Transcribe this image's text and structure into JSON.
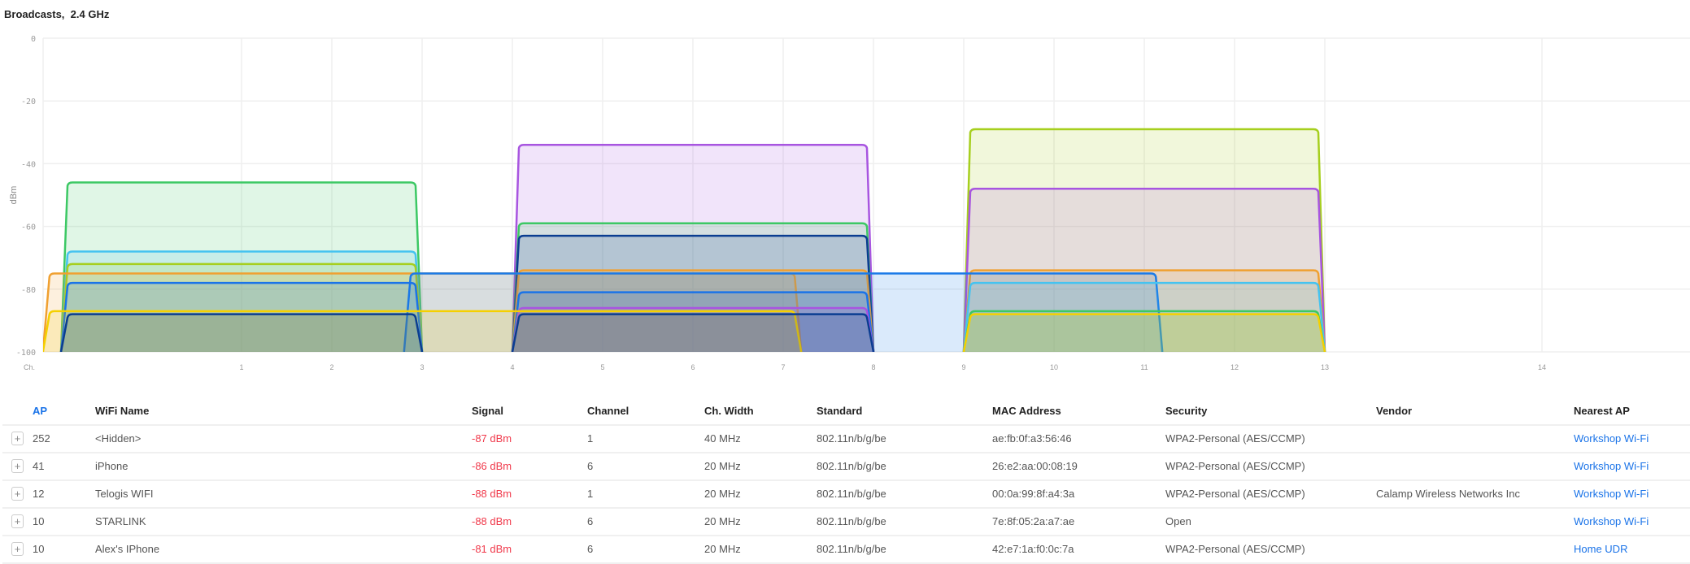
{
  "title": "Broadcasts,  2.4 GHz",
  "chart_data": {
    "type": "area",
    "ylabel": "dBm",
    "xlabel": "Ch.",
    "ylim": [
      -100,
      0
    ],
    "yticks": [
      "0",
      "-20",
      "-40",
      "-60",
      "-80",
      "-100"
    ],
    "xticks": [
      "1",
      "2",
      "3",
      "4",
      "5",
      "6",
      "7",
      "8",
      "9",
      "10",
      "11",
      "12",
      "13",
      "14"
    ],
    "series": [
      {
        "center": 11,
        "width_mhz": 20,
        "dbm": -29,
        "color": "#a6cf1e"
      },
      {
        "center": 6,
        "width_mhz": 20,
        "dbm": -34,
        "color": "#a855e0"
      },
      {
        "center": 1,
        "width_mhz": 20,
        "dbm": -46,
        "color": "#3cc864"
      },
      {
        "center": 11,
        "width_mhz": 20,
        "dbm": -48,
        "color": "#a855e0"
      },
      {
        "center": 6,
        "width_mhz": 20,
        "dbm": -59,
        "color": "#3cc864"
      },
      {
        "center": 6,
        "width_mhz": 20,
        "dbm": -63,
        "color": "#0a3d91"
      },
      {
        "center": 1,
        "width_mhz": 20,
        "dbm": -68,
        "color": "#45c3f0"
      },
      {
        "center": 1,
        "width_mhz": 20,
        "dbm": -72,
        "color": "#a6cf1e"
      },
      {
        "center": 6,
        "width_mhz": 20,
        "dbm": -74,
        "color": "#f0a030"
      },
      {
        "center": 11,
        "width_mhz": 20,
        "dbm": -74,
        "color": "#f0a030"
      },
      {
        "center": 3,
        "width_mhz": 40,
        "dbm": -75,
        "color": "#f0a030"
      },
      {
        "center": 7,
        "width_mhz": 40,
        "dbm": -75,
        "color": "#1a7ae8"
      },
      {
        "center": 1,
        "width_mhz": 20,
        "dbm": -78,
        "color": "#1a73e8"
      },
      {
        "center": 11,
        "width_mhz": 20,
        "dbm": -78,
        "color": "#45c3f0"
      },
      {
        "center": 6,
        "width_mhz": 20,
        "dbm": -81,
        "color": "#1a73e8"
      },
      {
        "center": 6,
        "width_mhz": 20,
        "dbm": -86,
        "color": "#a855e0"
      },
      {
        "center": 3,
        "width_mhz": 40,
        "dbm": -87,
        "color": "#f5d000"
      },
      {
        "center": 11,
        "width_mhz": 20,
        "dbm": -87,
        "color": "#3cc864"
      },
      {
        "center": 1,
        "width_mhz": 20,
        "dbm": -88,
        "color": "#0a3d91"
      },
      {
        "center": 6,
        "width_mhz": 20,
        "dbm": -88,
        "color": "#0a3d91"
      },
      {
        "center": 11,
        "width_mhz": 20,
        "dbm": -88,
        "color": "#f5d000"
      }
    ]
  },
  "table": {
    "headers": {
      "ap": "AP",
      "name": "WiFi Name",
      "signal": "Signal",
      "channel": "Channel",
      "width": "Ch. Width",
      "standard": "Standard",
      "mac": "MAC Address",
      "security": "Security",
      "vendor": "Vendor",
      "nearest": "Nearest AP"
    },
    "expand_icon": "+",
    "rows": [
      {
        "ap": "252",
        "name": "<Hidden>",
        "signal": "-87 dBm",
        "channel": "1",
        "width": "40 MHz",
        "standard": "802.11n/b/g/be",
        "mac": "ae:fb:0f:a3:56:46",
        "security": "WPA2-Personal (AES/CCMP)",
        "vendor": "",
        "nearest": "Workshop Wi-Fi"
      },
      {
        "ap": "41",
        "name": "iPhone",
        "signal": "-86 dBm",
        "channel": "6",
        "width": "20 MHz",
        "standard": "802.11n/b/g/be",
        "mac": "26:e2:aa:00:08:19",
        "security": "WPA2-Personal (AES/CCMP)",
        "vendor": "",
        "nearest": "Workshop Wi-Fi"
      },
      {
        "ap": "12",
        "name": "Telogis WIFI",
        "signal": "-88 dBm",
        "channel": "1",
        "width": "20 MHz",
        "standard": "802.11n/b/g/be",
        "mac": "00:0a:99:8f:a4:3a",
        "security": "WPA2-Personal (AES/CCMP)",
        "vendor": "Calamp Wireless Networks Inc",
        "nearest": "Workshop Wi-Fi"
      },
      {
        "ap": "10",
        "name": "STARLINK",
        "signal": "-88 dBm",
        "channel": "6",
        "width": "20 MHz",
        "standard": "802.11n/b/g/be",
        "mac": "7e:8f:05:2a:a7:ae",
        "security": "Open",
        "vendor": "",
        "nearest": "Workshop Wi-Fi"
      },
      {
        "ap": "10",
        "name": "Alex's IPhone",
        "signal": "-81 dBm",
        "channel": "6",
        "width": "20 MHz",
        "standard": "802.11n/b/g/be",
        "mac": "42:e7:1a:f0:0c:7a",
        "security": "WPA2-Personal (AES/CCMP)",
        "vendor": "",
        "nearest": "Home UDR"
      }
    ]
  }
}
